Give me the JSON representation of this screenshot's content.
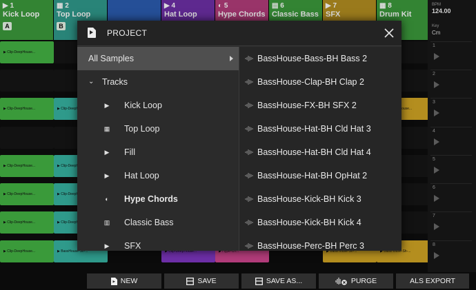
{
  "launcher": {
    "tracks": [
      {
        "num": "▶ 1",
        "name": "Kick Loop",
        "badge": "A",
        "color": "#3a9a3a"
      },
      {
        "num": "▦ 2",
        "name": "Top Loop",
        "badge": "B",
        "color": "#2f9a8b"
      },
      {
        "num": "",
        "name": "",
        "badge": "",
        "color": "#2a5bb0"
      },
      {
        "num": "▶ 4",
        "name": "Hat Loop",
        "badge": "",
        "color": "#6d2fa7"
      },
      {
        "num": "◐ 5",
        "name": "Hype Chords",
        "badge": "",
        "color": "#b23c7a"
      },
      {
        "num": "▤ 6",
        "name": "Classic Bass",
        "badge": "",
        "color": "#3a9a3a"
      },
      {
        "num": "▶ 7",
        "name": "SFX",
        "badge": "",
        "color": "#b48e1f"
      },
      {
        "num": "▦ 8",
        "name": "Drum Kit",
        "badge": "",
        "color": "#3a9a3a"
      }
    ],
    "clips": [
      {
        "label": "▶ Clip-DeepHouse...",
        "style": "green"
      },
      {
        "label": "▶ Clip-DeepHouse...",
        "style": "teal"
      },
      {
        "label": "▶ BassHouse-Sh-...",
        "style": "teal"
      },
      {
        "label": "▶ Clip-DeepHouse...",
        "style": "violet"
      },
      {
        "label": "▶ Hype-Ch...",
        "style": "pink"
      },
      {
        "label": "▶ Clip-DeepHouse...",
        "style": "gold"
      },
      {
        "label": "▶ BassHouse-Sh-...",
        "style": "gold"
      }
    ],
    "tempo_label": "BPM",
    "tempo": "124.00",
    "key_label": "Key",
    "key": "Cm",
    "scenes": [
      "1",
      "2",
      "3",
      "4",
      "5",
      "6",
      "7",
      "8"
    ]
  },
  "modal": {
    "title": "PROJECT",
    "nav": [
      {
        "label": "All Samples",
        "kind": "root",
        "icon": ""
      },
      {
        "label": "Tracks",
        "kind": "group",
        "icon": ""
      },
      {
        "label": "Kick Loop",
        "kind": "track",
        "icon": "play-track-icon"
      },
      {
        "label": "Top Loop",
        "kind": "track",
        "icon": "grid-track-icon"
      },
      {
        "label": "Fill",
        "kind": "track",
        "icon": "play-track-icon"
      },
      {
        "label": "Hat Loop",
        "kind": "track",
        "icon": "play-track-icon"
      },
      {
        "label": "Hype Chords",
        "kind": "track",
        "icon": "half-circle-track-icon"
      },
      {
        "label": "Classic Bass",
        "kind": "track",
        "icon": "keys-track-icon"
      },
      {
        "label": "SFX",
        "kind": "track",
        "icon": "play-track-icon"
      }
    ],
    "samples": [
      "BassHouse-Bass-BH Bass 2",
      "BassHouse-Clap-BH Clap 2",
      "BassHouse-FX-BH SFX 2",
      "BassHouse-Hat-BH Cld Hat 3",
      "BassHouse-Hat-BH Cld Hat 4",
      "BassHouse-Hat-BH OpHat 2",
      "BassHouse-Kick-BH Kick 3",
      "BassHouse-Kick-BH Kick 4",
      "BassHouse-Perc-BH Perc 3"
    ]
  },
  "bottom_bar": {
    "new_label": "NEW",
    "save_label": "SAVE",
    "save_as_label": "SAVE AS...",
    "purge_label": "PURGE",
    "als_export_label": "ALS EXPORT"
  },
  "colors": {
    "modal_bg": "#2b2b2b",
    "selected_row": "#4f4f4f",
    "button_bg": "#2f2f2f",
    "kick": "#3a9a3a",
    "top": "#2f9a8b",
    "hype": "#b23c7a",
    "sfx": "#b48e1f",
    "hat": "#6d2fa7"
  }
}
